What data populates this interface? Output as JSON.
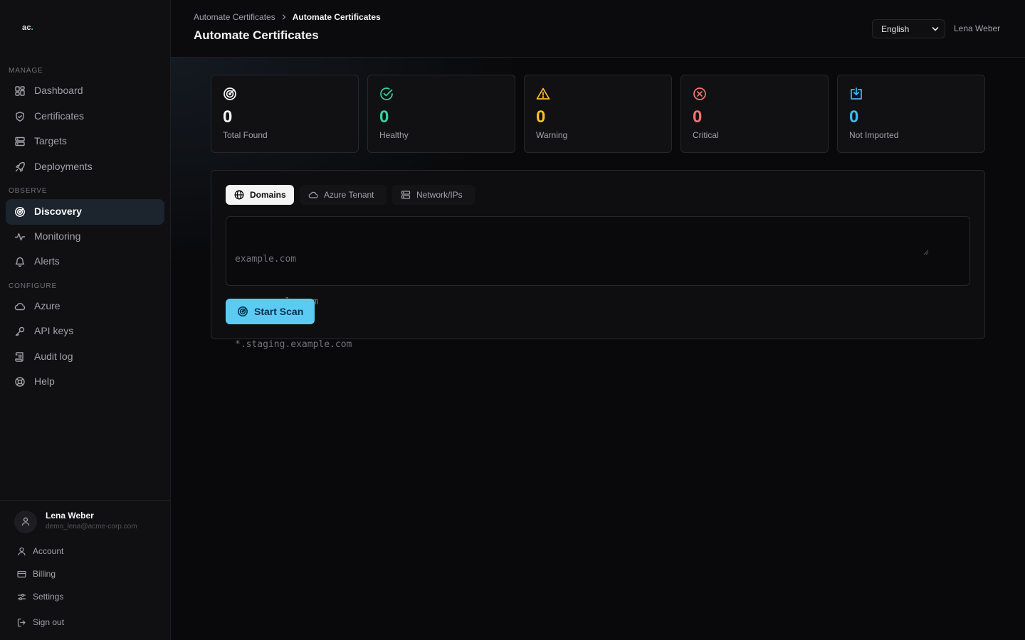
{
  "brand": {
    "logo_text": "ac",
    "logo_dot": "."
  },
  "sidebar": {
    "sections": [
      {
        "label": "MANAGE",
        "items": [
          {
            "label": "Dashboard",
            "icon": "dashboard-icon"
          },
          {
            "label": "Certificates",
            "icon": "shield-icon"
          },
          {
            "label": "Targets",
            "icon": "server-icon"
          },
          {
            "label": "Deployments",
            "icon": "rocket-icon"
          }
        ]
      },
      {
        "label": "OBSERVE",
        "items": [
          {
            "label": "Discovery",
            "icon": "radar-icon",
            "active": true
          },
          {
            "label": "Monitoring",
            "icon": "activity-icon"
          },
          {
            "label": "Alerts",
            "icon": "bell-icon"
          }
        ]
      },
      {
        "label": "CONFIGURE",
        "items": [
          {
            "label": "Azure",
            "icon": "cloud-icon"
          },
          {
            "label": "API keys",
            "icon": "key-icon"
          },
          {
            "label": "Audit log",
            "icon": "scroll-icon"
          },
          {
            "label": "Help",
            "icon": "lifebuoy-icon"
          }
        ]
      }
    ],
    "user": {
      "name": "Lena Weber",
      "email": "demo_lena@acme-corp.com",
      "links": [
        {
          "label": "Account",
          "icon": "user-icon"
        },
        {
          "label": "Billing",
          "icon": "credit-card-icon"
        },
        {
          "label": "Settings",
          "icon": "sliders-icon"
        },
        {
          "label": "Sign out",
          "icon": "sign-out-icon"
        }
      ]
    }
  },
  "header": {
    "breadcrumb": [
      "Automate Certificates",
      "Automate Certificates"
    ],
    "title": "Automate Certificates",
    "language": "English",
    "user_name": "Lena Weber"
  },
  "stats": [
    {
      "value": "0",
      "caption": "Total Found",
      "color": "#f4f4f5",
      "icon": "radar-icon"
    },
    {
      "value": "0",
      "caption": "Healthy",
      "color": "#34d399",
      "icon": "check-circle-icon"
    },
    {
      "value": "0",
      "caption": "Warning",
      "color": "#fbbf24",
      "icon": "warning-icon"
    },
    {
      "value": "0",
      "caption": "Critical",
      "color": "#f87171",
      "icon": "x-circle-icon"
    },
    {
      "value": "0",
      "caption": "Not Imported",
      "color": "#38bdf8",
      "icon": "import-icon"
    }
  ],
  "scan": {
    "tabs": [
      {
        "label": "Domains",
        "icon": "globe-icon",
        "active": true
      },
      {
        "label": "Azure Tenant",
        "icon": "cloud-icon"
      },
      {
        "label": "Network/IPs",
        "icon": "server-icon"
      }
    ],
    "placeholder_lines": [
      "example.com",
      "app.example.com",
      "*.staging.example.com"
    ],
    "button_label": "Start Scan"
  },
  "colors": {
    "accent": "#5ccbf4",
    "background": "#09090b"
  }
}
